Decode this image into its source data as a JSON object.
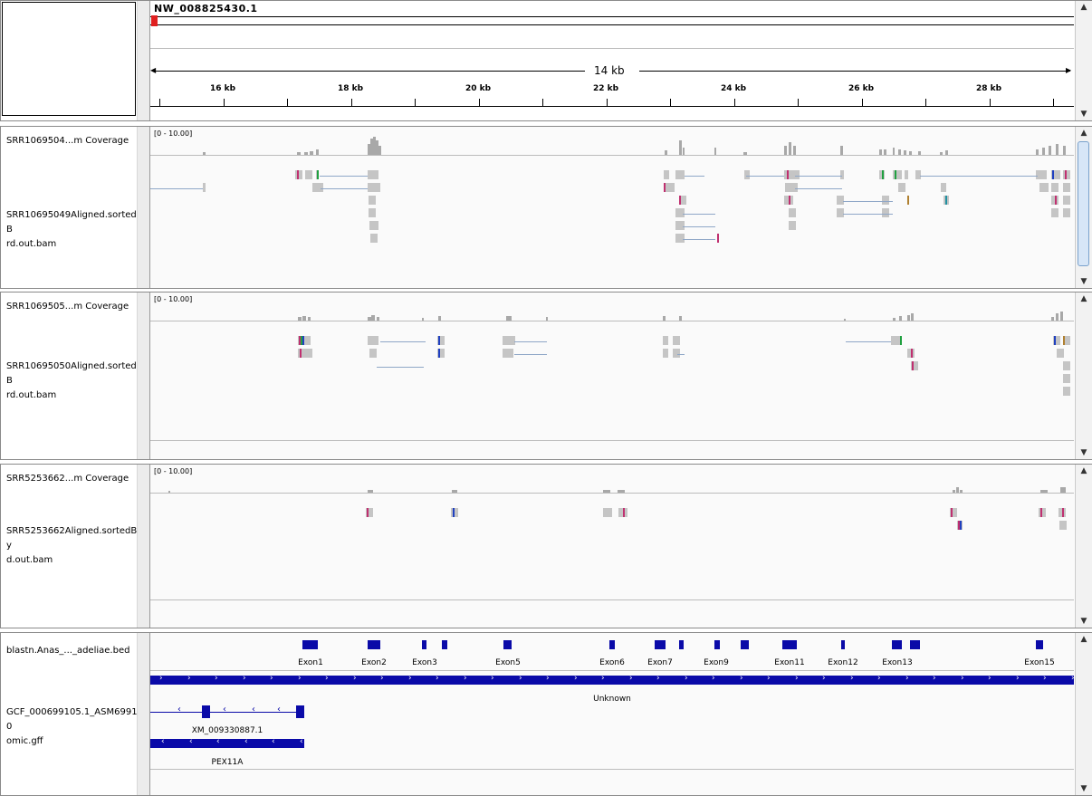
{
  "ruler": {
    "chromosome": "NW_008825430.1",
    "span": "14 kb",
    "ticks": [
      {
        "label": "16 kb",
        "pos": 80
      },
      {
        "label": "18 kb",
        "pos": 221
      },
      {
        "label": "20 kb",
        "pos": 362
      },
      {
        "label": "22 kb",
        "pos": 503
      },
      {
        "label": "24 kb",
        "pos": 644
      },
      {
        "label": "26 kb",
        "pos": 785
      },
      {
        "label": "28 kb",
        "pos": 926
      }
    ]
  },
  "panels": [
    {
      "coverage_name": "SRR1069504...m Coverage",
      "range": "[0 - 10.00]",
      "alignment_name": "SRR10695049Aligned.sortedByCoord.out.bam",
      "alignment_display": "SRR10695049Aligned.sortedB\nrd.out.bam"
    },
    {
      "coverage_name": "SRR1069505...m Coverage",
      "range": "[0 - 10.00]",
      "alignment_name": "SRR10695050Aligned.sortedByCoord.out.bam",
      "alignment_display": "SRR10695050Aligned.sortedB\nrd.out.bam"
    },
    {
      "coverage_name": "SRR5253662...m Coverage",
      "range": "[0 - 10.00]",
      "alignment_name": "SRR5253662Aligned.sortedByCoord.out.bam",
      "alignment_display": "SRR5253662Aligned.sortedBy\nd.out.bam"
    }
  ],
  "features": {
    "bed_name": "blastn.Anas_..._adeliae.bed",
    "gff_name": "GCF_000699105.1_ASM69910\nomic.gff",
    "exons": [
      {
        "label": "Exon1",
        "pos": 177
      },
      {
        "label": "Exon2",
        "pos": 247
      },
      {
        "label": "Exon3",
        "pos": 303
      },
      {
        "label": "Exon5",
        "pos": 395
      },
      {
        "label": "Exon6",
        "pos": 510
      },
      {
        "label": "Exon7",
        "pos": 563
      },
      {
        "label": "Exon9",
        "pos": 625
      },
      {
        "label": "Exon11",
        "pos": 706
      },
      {
        "label": "Exon12",
        "pos": 765
      },
      {
        "label": "Exon13",
        "pos": 825
      },
      {
        "label": "Exon15",
        "pos": 982
      }
    ],
    "unknown_label": "Unknown",
    "transcript_label": "XM_009330887.1",
    "gene_label": "PEX11A"
  },
  "colors": {
    "feature": "#0a0aa8",
    "coverage": "#a8a8a8",
    "read": "#c5c5c5",
    "selection": "#e02020"
  }
}
